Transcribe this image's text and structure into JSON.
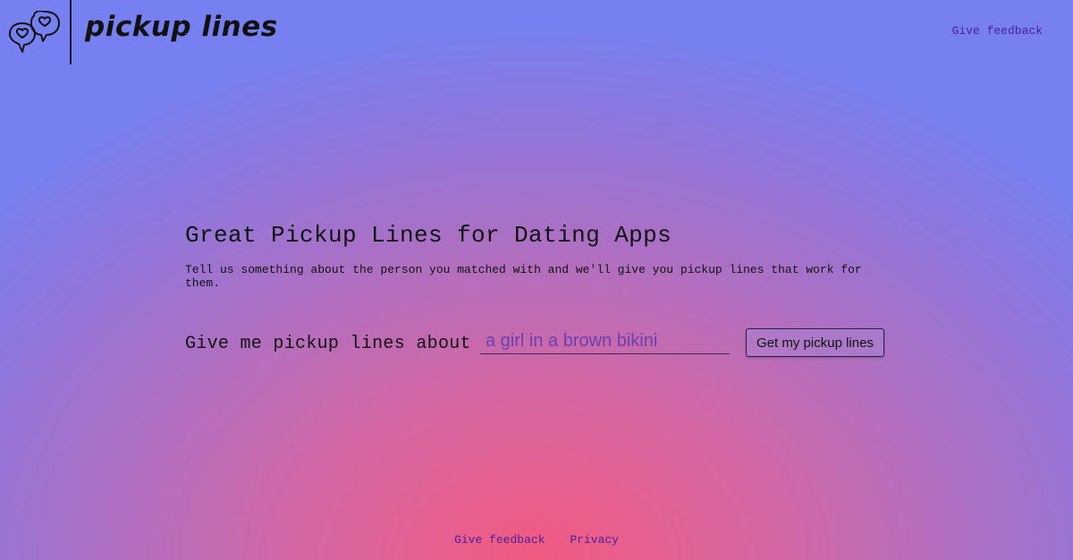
{
  "header": {
    "logo_text": "pickup lines",
    "logo_icon": "speech-bubbles-hearts-icon",
    "feedback_link": "Give feedback"
  },
  "main": {
    "title": "Great Pickup Lines for Dating Apps",
    "subtitle": "Tell us something about the person you matched with and we'll give you pickup lines that work for them.",
    "form": {
      "label": "Give me pickup lines about",
      "input_placeholder": "a girl in a brown bikini",
      "input_value": "",
      "submit_label": "Get my pickup lines"
    }
  },
  "footer": {
    "links": [
      "Give feedback",
      "Privacy"
    ]
  },
  "colors": {
    "link": "#4b1e9e",
    "background_center": "#f25a80",
    "background_edge": "#7680f0"
  }
}
